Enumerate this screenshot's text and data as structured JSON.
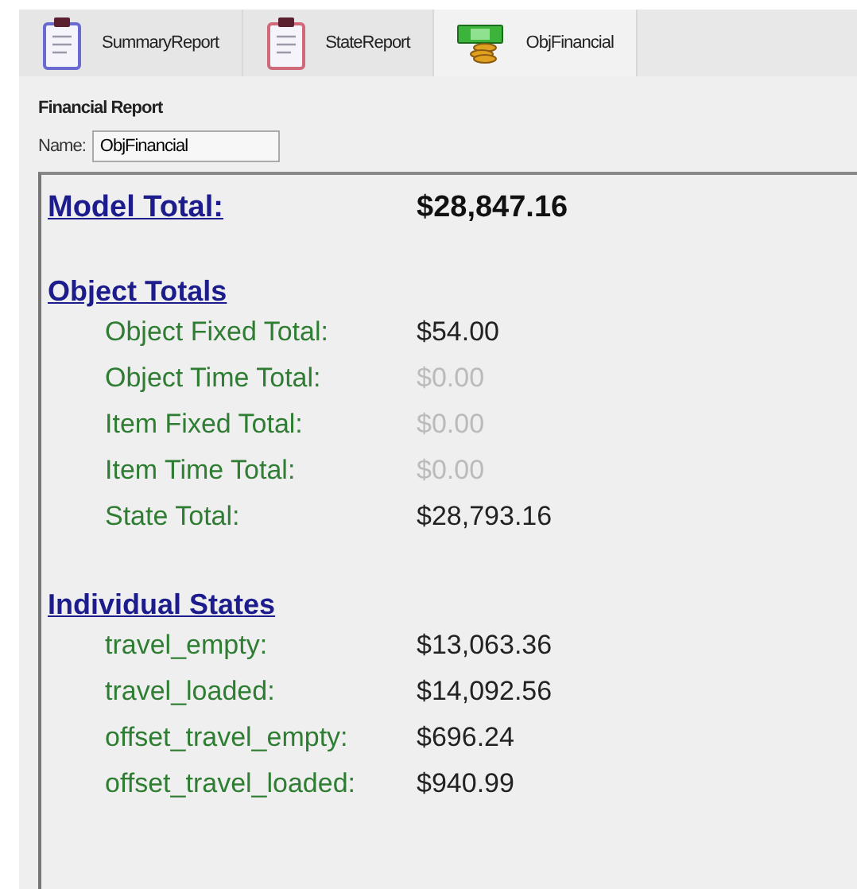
{
  "tabs": [
    {
      "label": "SummaryReport",
      "kind": "clipboard",
      "color": "#6a6ad0",
      "selected": false
    },
    {
      "label": "StateReport",
      "kind": "clipboard",
      "color": "#d06a7a",
      "selected": false
    },
    {
      "label": "ObjFinancial",
      "kind": "money",
      "selected": true
    }
  ],
  "panel": {
    "title": "Financial Report",
    "name_label": "Name:",
    "name_value": "ObjFinancial"
  },
  "report": {
    "total": {
      "label": "Model Total:",
      "value": "$28,847.16"
    },
    "sections": [
      {
        "heading": "Object Totals",
        "rows": [
          {
            "label": "Object Fixed Total:",
            "value": "$54.00",
            "dimmed": false
          },
          {
            "label": "Object Time Total:",
            "value": "$0.00",
            "dimmed": true
          },
          {
            "label": "Item Fixed Total:",
            "value": "$0.00",
            "dimmed": true
          },
          {
            "label": "Item Time Total:",
            "value": "$0.00",
            "dimmed": true
          },
          {
            "label": "State Total:",
            "value": "$28,793.16",
            "dimmed": false
          }
        ]
      },
      {
        "heading": "Individual States",
        "rows": [
          {
            "label": "travel_empty:",
            "value": "$13,063.36",
            "dimmed": false
          },
          {
            "label": "travel_loaded:",
            "value": "$14,092.56",
            "dimmed": false
          },
          {
            "label": "offset_travel_empty:",
            "value": "$696.24",
            "dimmed": false
          },
          {
            "label": "offset_travel_loaded:",
            "value": "$940.99",
            "dimmed": false
          }
        ]
      }
    ]
  }
}
